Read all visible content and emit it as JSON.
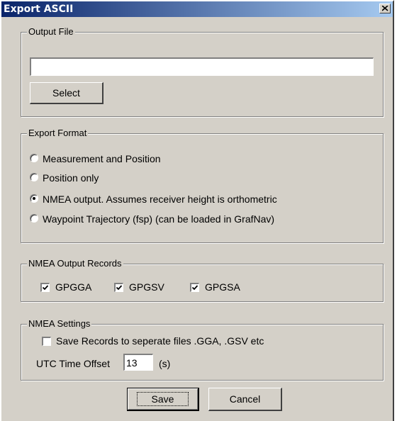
{
  "window": {
    "title": "Export ASCII"
  },
  "output_file": {
    "legend": "Output File",
    "path_value": "",
    "select_label": "Select"
  },
  "export_format": {
    "legend": "Export Format",
    "options": [
      {
        "label": "Measurement and Position",
        "selected": false
      },
      {
        "label": "Position only",
        "selected": false
      },
      {
        "label": "NMEA output.  Assumes receiver height is orthometric",
        "selected": true
      },
      {
        "label": "Waypoint Trajectory (fsp) (can be loaded in GrafNav)",
        "selected": false
      }
    ]
  },
  "nmea_records": {
    "legend": "NMEA Output Records",
    "items": [
      {
        "label": "GPGGA",
        "checked": true
      },
      {
        "label": "GPGSV",
        "checked": true
      },
      {
        "label": "GPGSA",
        "checked": true
      }
    ]
  },
  "nmea_settings": {
    "legend": "NMEA Settings",
    "separate_files_label": "Save Records to seperate files .GGA, .GSV etc",
    "separate_files_checked": false,
    "utc_offset_label": "UTC Time Offset",
    "utc_offset_value": "13",
    "utc_offset_unit": "(s)"
  },
  "buttons": {
    "save": "Save",
    "cancel": "Cancel"
  }
}
